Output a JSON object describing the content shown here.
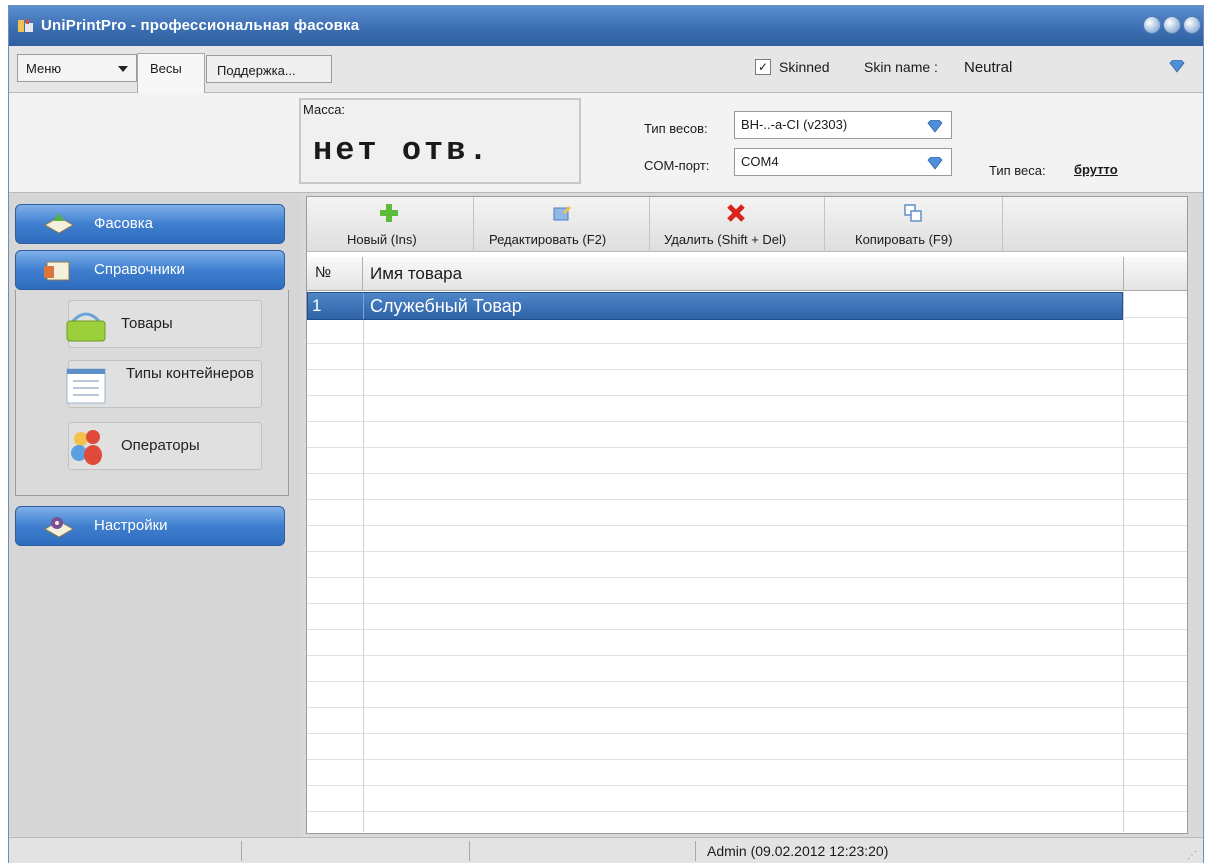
{
  "window": {
    "title": "UniPrintPro - профессиональная фасовка"
  },
  "tabs": {
    "menu_label": "Меню",
    "weights_label": "Весы",
    "support_label": "Поддержка...",
    "skinned_label": "Skinned",
    "skinned_checked": true,
    "skin_name_label": "Skin name :",
    "skin_name_value": "Neutral"
  },
  "weight_panel": {
    "mass_label": "Масса:",
    "mass_value": "нет отв.",
    "scale_type_label": "Тип весов:",
    "scale_type_value": "ВН-..-а-CI (v2303)",
    "com_port_label": "COM-порт:",
    "com_port_value": "COM4",
    "weight_type_label": "Тип веса:",
    "weight_type_value": "брутто"
  },
  "sidebar": {
    "packing": "Фасовка",
    "references": "Справочники",
    "items": [
      {
        "label": "Товары",
        "icon": "basket-icon"
      },
      {
        "label": "Типы контейнеров",
        "icon": "list-icon"
      },
      {
        "label": "Операторы",
        "icon": "users-icon"
      }
    ],
    "settings": "Настройки"
  },
  "toolbar": {
    "new_label": "Новый (Ins)",
    "edit_label": "Редактировать (F2)",
    "delete_label": "Удалить (Shift + Del)",
    "copy_label": "Копировать (F9)"
  },
  "grid": {
    "columns": [
      "№",
      "Имя товара"
    ],
    "rows": [
      {
        "num": "1",
        "name": "Служебный Товар",
        "selected": true
      }
    ]
  },
  "statusbar": {
    "user": "Admin (09.02.2012 12:23:20)"
  },
  "colors": {
    "accent": "#3f7fcf",
    "title_bar": "#3c6fb3",
    "selection": "#2e62a8"
  }
}
